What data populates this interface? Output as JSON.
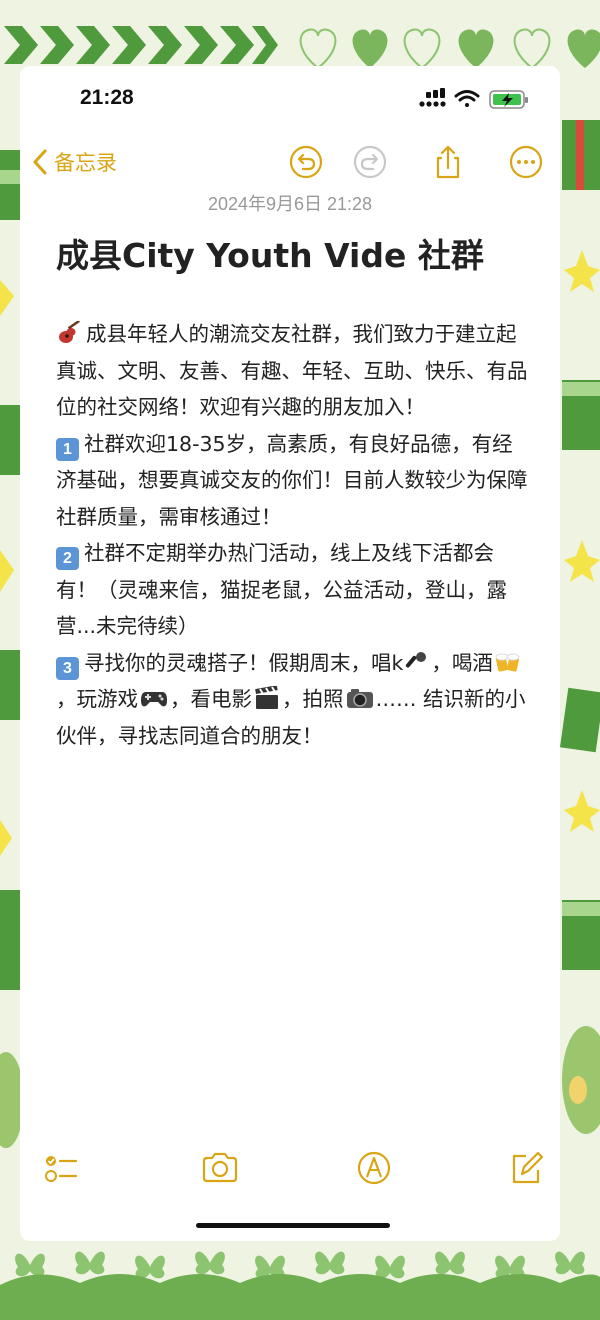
{
  "status_bar": {
    "time": "21:28",
    "icons": [
      "cellular-signal-icon",
      "wifi-icon",
      "battery-charging-icon"
    ]
  },
  "nav": {
    "back_label": "备忘录",
    "icons": [
      "chevron-left-icon",
      "undo-icon",
      "redo-icon",
      "share-icon",
      "more-icon"
    ]
  },
  "note": {
    "date": "2024年9月6日 21:28",
    "title": "成县City Youth Vide 社群",
    "intro": "成县年轻人的潮流交友社群，我们致力于建立起真诚、文明、友善、有趣、年轻、互助、快乐、有品位的社交网络！欢迎有兴趣的朋友加入！",
    "points": [
      {
        "num": "1",
        "text": "社群欢迎18-35岁，高素质，有良好品德，有经济基础，想要真诚交友的你们！目前人数较少为保障社群质量，需审核通过！"
      },
      {
        "num": "2",
        "text": "社群不定期举办热门活动，线上及线下活都会有！（灵魂来信，猫捉老鼠，公益活动，登山，露营...未完待续）"
      }
    ],
    "point3": {
      "num": "3",
      "a": "寻找你的灵魂搭子！假期周末，唱k",
      "b": "，喝酒",
      "c": "，玩游戏",
      "d": "，看电影",
      "e": "，拍照",
      "f": "…… 结识新的小伙伴，寻找志同道合的朋友！"
    },
    "emoji_icons": [
      "guitar-icon",
      "microphone-icon",
      "beer-mugs-icon",
      "game-controller-icon",
      "clapperboard-icon",
      "camera-icon"
    ]
  },
  "toolbar": {
    "icons": [
      "checklist-icon",
      "camera-icon",
      "markup-pen-icon",
      "compose-icon"
    ]
  },
  "colors": {
    "accent": "#d9a514",
    "frame_green": "#4e9a3c",
    "light_green": "#a9d68d",
    "background": "#eef3e2"
  }
}
